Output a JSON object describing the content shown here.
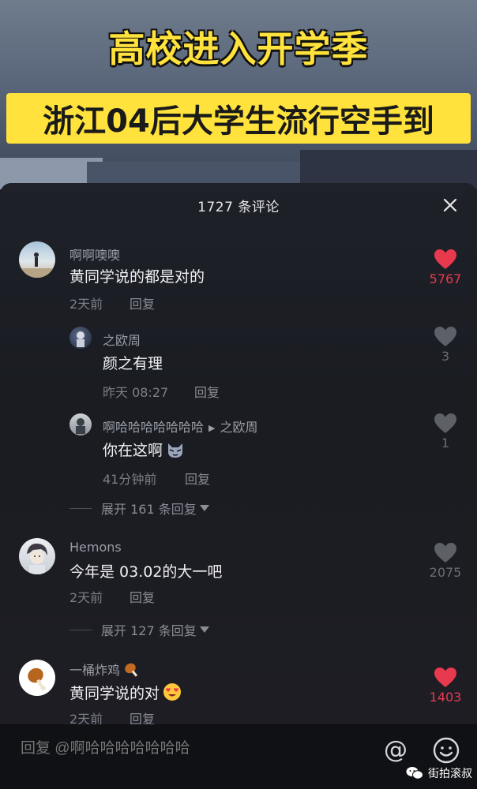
{
  "video": {
    "title_line1": "高校进入开学季",
    "title_line2": "浙江04后大学生流行空手到"
  },
  "panel": {
    "title": "1727 条评论"
  },
  "comments": [
    {
      "name": "啊啊噢噢",
      "text": "黄同学说的都是对的",
      "time": "2天前",
      "reply_label": "回复",
      "likes": "5767",
      "liked": true
    },
    {
      "name": "之欧周",
      "text": "颜之有理",
      "time": "昨天 08:27",
      "reply_label": "回复",
      "likes": "3",
      "liked": false
    },
    {
      "name": "啊哈哈哈哈哈哈哈",
      "reply_to": "之欧周",
      "text": "你在这啊",
      "time": "41分钟前",
      "reply_label": "回复",
      "likes": "1",
      "liked": false
    },
    {
      "name": "Hemons",
      "text": "今年是 03.02的大一吧",
      "time": "2天前",
      "reply_label": "回复",
      "likes": "2075",
      "liked": false
    },
    {
      "name": "一桶炸鸡",
      "text": "黄同学说的对",
      "time": "2天前",
      "reply_label": "回复",
      "likes": "1403",
      "liked": true
    }
  ],
  "expand": [
    {
      "label": "展开 161 条回复"
    },
    {
      "label": "展开 127 条回复"
    }
  ],
  "input": {
    "placeholder": "回复 @啊哈哈哈哈哈哈哈"
  },
  "watermark": {
    "text": "街拍滚叔"
  },
  "colors": {
    "title_yellow": "#ffe23b",
    "like_red": "#e8394f",
    "panel_bg": "#1a1c22"
  }
}
